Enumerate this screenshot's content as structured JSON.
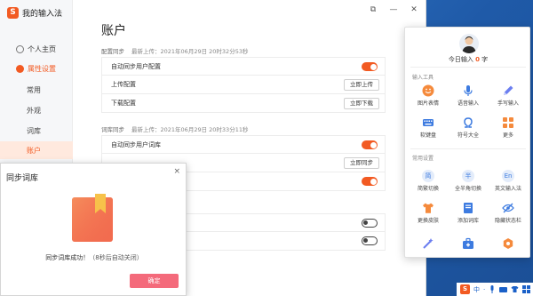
{
  "app": {
    "logo_glyph": "S",
    "title": "我的输入法"
  },
  "window_controls": {
    "restore": "⧉",
    "minimize": "—",
    "close": "✕"
  },
  "sidebar": {
    "items": [
      {
        "label": "个人主页"
      },
      {
        "label": "属性设置"
      },
      {
        "label": "常用"
      },
      {
        "label": "外观"
      },
      {
        "label": "词库"
      },
      {
        "label": "账户"
      }
    ]
  },
  "main": {
    "title": "账户",
    "config_sync": {
      "header": "配置同步",
      "last_upload": "最新上传：2021年06月29日 20时32分53秒",
      "auto_label": "自动同步用户配置",
      "upload_label": "上传配置",
      "upload_btn": "立即上传",
      "download_label": "下载配置",
      "download_btn": "立即下载"
    },
    "dict_sync": {
      "header": "词库同步",
      "last_upload": "最新上传：2021年06月29日 20时33分11秒",
      "auto_label": "自动同步用户词库",
      "sync_btn": "立即同步"
    }
  },
  "dialog": {
    "title": "同步词库",
    "close": "×",
    "message": "同步词库成功！",
    "hint": "（8秒后自动关闭）",
    "ok": "确定"
  },
  "panel": {
    "today_prefix": "今日输入",
    "today_count": "0",
    "today_suffix": "字",
    "tools_label": "输入工具",
    "tools": [
      {
        "label": "图片表情",
        "icon": "smile-icon"
      },
      {
        "label": "语音输入",
        "icon": "microphone-icon"
      },
      {
        "label": "手写输入",
        "icon": "pen-icon"
      },
      {
        "label": "软键盘",
        "icon": "keyboard-icon"
      },
      {
        "label": "符号大全",
        "icon": "omega-icon"
      },
      {
        "label": "更多",
        "icon": "grid-icon"
      }
    ],
    "settings_label": "常用设置",
    "settings": [
      {
        "label": "简繁切换",
        "glyph": "简"
      },
      {
        "label": "全半角切换",
        "glyph": "半"
      },
      {
        "label": "英文输入法",
        "glyph": "En"
      },
      {
        "label": "更换皮肤",
        "icon": "shirt-icon"
      },
      {
        "label": "添加词库",
        "icon": "book-icon"
      },
      {
        "label": "隐藏状态栏",
        "icon": "eye-off-icon"
      }
    ]
  },
  "tray": {
    "logo_glyph": "S",
    "ime_mode": "中"
  },
  "colors": {
    "accent": "#f25a22",
    "ok_button": "#f46a7b",
    "icon_blue": "#3d7be0"
  }
}
